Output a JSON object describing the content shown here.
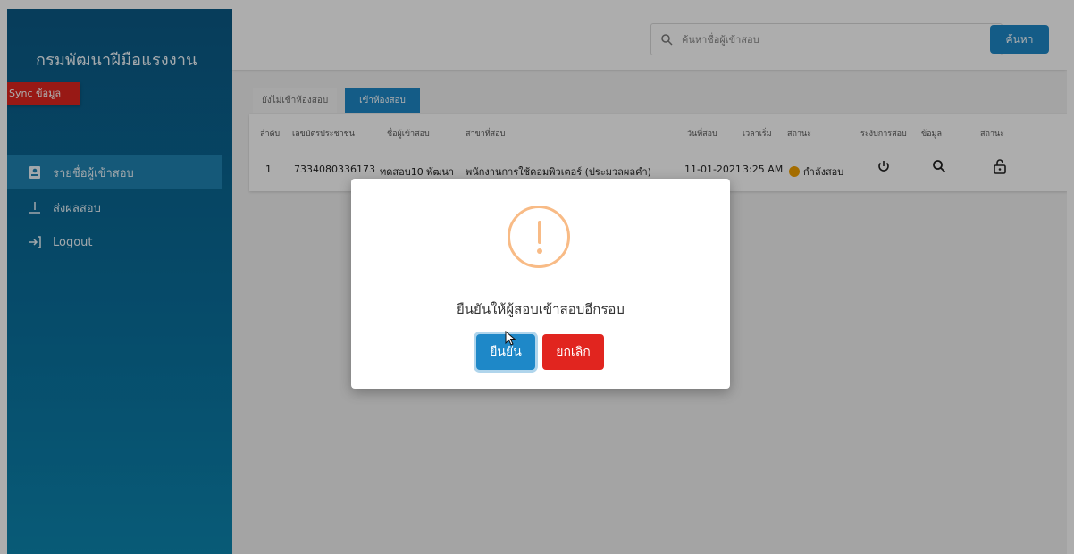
{
  "sidebar": {
    "brand": "กรมพัฒนาฝีมือแรงงาน",
    "sync_label": "Sync ข้อมูล",
    "items": [
      {
        "label": "รายชื่อผู้เข้าสอบ",
        "icon": "id-card-icon",
        "active": true
      },
      {
        "label": "ส่งผลสอบ",
        "icon": "download-icon",
        "active": false
      },
      {
        "label": "Logout",
        "icon": "logout-icon",
        "active": false
      }
    ]
  },
  "topbar": {
    "search_placeholder": "ค้นหาชื่อผู้เข้าสอบ",
    "search_button": "ค้นหา"
  },
  "tabs": {
    "not_entered": "ยังไม่เข้าห้องสอบ",
    "entered": "เข้าห้องสอบ"
  },
  "table": {
    "headers": {
      "no": "ลำดับ",
      "id_card": "เลขบัตรประชาชน",
      "name": "ชื่อผู้เข้าสอบ",
      "branch": "สาขาที่สอบ",
      "date": "วันที่สอบ",
      "time": "เวลาเริ่ม",
      "status": "สถานะ",
      "suspend": "ระงับการสอบ",
      "info": "ข้อมูล",
      "status2": "สถานะ"
    },
    "row": {
      "no": "1",
      "id_card": "7334080336173",
      "name": "ทดสอบ10 พัฒนา",
      "branch": "พนักงานการใช้คอมพิวเตอร์ (ประมวลผลคำ)",
      "date": "11-01-2021",
      "time": "3:25 AM",
      "status": "กำลังสอบ"
    }
  },
  "modal": {
    "message": "ยืนยันให้ผู้สอบเข้าสอบอีกรอบ",
    "confirm": "ยืนยัน",
    "cancel": "ยกเลิก"
  },
  "colors": {
    "accent": "#1e88c8",
    "danger": "#e1251f",
    "warning_icon": "#f8bb86",
    "status_dot": "#f2a100"
  }
}
